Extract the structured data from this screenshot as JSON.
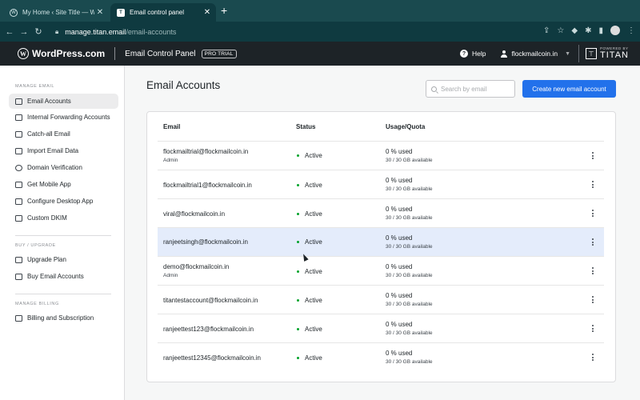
{
  "browser": {
    "tabs": [
      {
        "title": "My Home ‹ Site Title — WordP…",
        "close": "✕"
      },
      {
        "title": "Email control panel",
        "close": "✕"
      }
    ],
    "new_tab": "+",
    "url_host": "manage.titan.email",
    "url_path": "/email-accounts"
  },
  "header": {
    "logo": "WordPress.com",
    "panel_title": "Email Control Panel",
    "badge": "PRO TRIAL",
    "help": "Help",
    "account": "flockmailcoin.in",
    "powered_by": "POWERED BY",
    "brand": "TITAN"
  },
  "sidebar": {
    "sections": [
      {
        "title": "MANAGE EMAIL"
      },
      {
        "title": "BUY / UPGRADE"
      },
      {
        "title": "MANAGE BILLING"
      }
    ],
    "items": [
      {
        "label": "Email Accounts",
        "icon": "mail-icon"
      },
      {
        "label": "Internal Forwarding Accounts",
        "icon": "forward-icon"
      },
      {
        "label": "Catch-all Email",
        "icon": "catch-all-icon"
      },
      {
        "label": "Import Email Data",
        "icon": "import-icon"
      },
      {
        "label": "Domain Verification",
        "icon": "globe-icon"
      },
      {
        "label": "Get Mobile App",
        "icon": "mobile-icon"
      },
      {
        "label": "Configure Desktop App",
        "icon": "desktop-icon"
      },
      {
        "label": "Custom DKIM",
        "icon": "key-icon"
      },
      {
        "label": "Upgrade Plan",
        "icon": "upgrade-icon"
      },
      {
        "label": "Buy Email Accounts",
        "icon": "cart-icon"
      },
      {
        "label": "Billing and Subscription",
        "icon": "billing-icon"
      }
    ]
  },
  "main": {
    "title": "Email Accounts",
    "search_placeholder": "Search by email",
    "create_button": "Create new email account",
    "columns": [
      "Email",
      "Status",
      "Usage/Quota"
    ],
    "rows": [
      {
        "email": "flockmailtrial@flockmailcoin.in",
        "role": "Admin",
        "status": "Active",
        "usage": "0 % used",
        "quota": "30 / 30 GB available"
      },
      {
        "email": "flockmailtrial1@flockmailcoin.in",
        "role": "",
        "status": "Active",
        "usage": "0 % used",
        "quota": "30 / 30 GB available"
      },
      {
        "email": "viral@flockmailcoin.in",
        "role": "",
        "status": "Active",
        "usage": "0 % used",
        "quota": "30 / 30 GB available"
      },
      {
        "email": "ranjeetsingh@flockmailcoin.in",
        "role": "",
        "status": "Active",
        "usage": "0 % used",
        "quota": "30 / 30 GB available"
      },
      {
        "email": "demo@flockmailcoin.in",
        "role": "Admin",
        "status": "Active",
        "usage": "0 % used",
        "quota": "30 / 30 GB available"
      },
      {
        "email": "titantestaccount@flockmailcoin.in",
        "role": "",
        "status": "Active",
        "usage": "0 % used",
        "quota": "30 / 30 GB available"
      },
      {
        "email": "ranjeettest123@flockmailcoin.in",
        "role": "",
        "status": "Active",
        "usage": "0 % used",
        "quota": "30 / 30 GB available"
      },
      {
        "email": "ranjeettest12345@flockmailcoin.in",
        "role": "",
        "status": "Active",
        "usage": "0 % used",
        "quota": "30 / 30 GB available"
      }
    ]
  },
  "colors": {
    "accent": "#2271eb",
    "active_dot": "#00a32a",
    "header_bg": "#1d2327",
    "row_highlight": "#e4ecfb"
  }
}
